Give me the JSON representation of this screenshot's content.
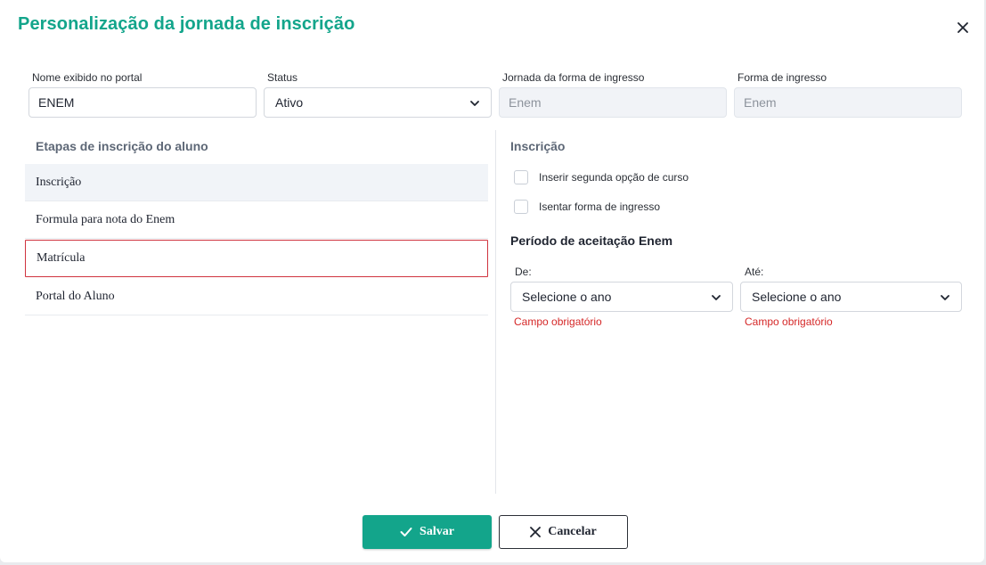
{
  "dialog": {
    "title": "Personalização da jornada de inscrição"
  },
  "fields": {
    "nome": {
      "label": "Nome exibido no portal",
      "value": "ENEM"
    },
    "status": {
      "label": "Status",
      "value": "Ativo"
    },
    "jornada": {
      "label": "Jornada da forma de ingresso",
      "placeholder": "Enem"
    },
    "forma": {
      "label": "Forma de ingresso",
      "placeholder": "Enem"
    }
  },
  "steps": {
    "title": "Etapas de inscrição do aluno",
    "items": [
      {
        "label": "Inscrição"
      },
      {
        "label": "Formula para nota do Enem"
      },
      {
        "label": "Matrícula"
      },
      {
        "label": "Portal do Aluno"
      }
    ]
  },
  "inscricao": {
    "title": "Inscrição",
    "options": [
      {
        "label": "Inserir segunda opção de curso"
      },
      {
        "label": "Isentar forma de ingresso"
      }
    ],
    "period": {
      "title": "Período de aceitação Enem",
      "from": {
        "label": "De:",
        "value": "Selecione o ano",
        "error": "Campo obrigatório"
      },
      "to": {
        "label": "Até:",
        "value": "Selecione o ano",
        "error": "Campo obrigatório"
      }
    }
  },
  "actions": {
    "save": "Salvar",
    "cancel": "Cancelar"
  },
  "colors": {
    "brand": "#13a58b",
    "error": "#d52828"
  }
}
